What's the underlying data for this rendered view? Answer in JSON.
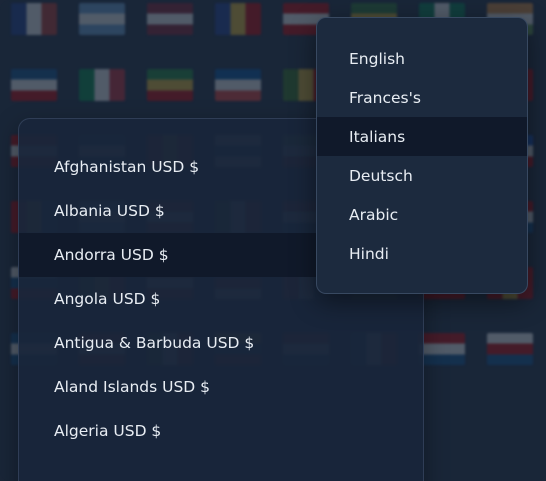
{
  "background_flags": [
    [
      "#1b3a8f",
      "#ffffff",
      "#c0392b"
    ],
    [
      "#6fa8dc",
      "#ffffff",
      "#6fa8dc"
    ],
    [
      "#8b1e2d",
      "#ffffff",
      "#8b1e2d"
    ],
    [
      "#1f3f9a",
      "#f1c232",
      "#cc0000"
    ],
    [
      "#cc0000",
      "#ffffff",
      "#cc0000"
    ],
    [
      "#2e7d32",
      "#f1c232",
      "#1565c0"
    ],
    [
      "#008751",
      "#ffffff",
      "#008751"
    ],
    [
      "#e69138",
      "#ffffff",
      "#6aa84f"
    ],
    [
      "#0b5394",
      "#ffffff",
      "#cc0000"
    ],
    [
      "#009246",
      "#ffffff",
      "#ce2b37"
    ],
    [
      "#1e8f3a",
      "#f1c232",
      "#cc0000"
    ],
    [
      "#0055a4",
      "#ffffff",
      "#ef4135"
    ],
    [
      "#38761d",
      "#f1c232",
      "#cc0000"
    ],
    [
      "#cc0000",
      "#ffffff",
      "#0b5394"
    ],
    [
      "#ffffff",
      "#cc0000",
      "#ffffff"
    ],
    [
      "#3d85c6",
      "#ffffff",
      "#cc0000"
    ],
    [
      "#cc0000",
      "#ffffff",
      "#cc0000"
    ],
    [
      "#0b5394",
      "#ffffff",
      "#0b5394"
    ],
    [
      "#cc0000",
      "#f1c232",
      "#cc0000"
    ],
    [
      "#ffffff",
      "#0b5394",
      "#ffffff"
    ],
    [
      "#6aa84f",
      "#ffffff",
      "#cc0000"
    ],
    [
      "#cc0000",
      "#ffffff",
      "#0b5394"
    ],
    [
      "#0b5394",
      "#ffffff",
      "#cc0000"
    ],
    [
      "#1155cc",
      "#ffffff",
      "#cc0000"
    ],
    [
      "#cc0000",
      "#f1c232",
      "#0b5394"
    ],
    [
      "#6fa8dc",
      "#ffffff",
      "#6fa8dc"
    ],
    [
      "#cc0000",
      "#ffffff",
      "#cc0000"
    ],
    [
      "#38761d",
      "#ffffff",
      "#cc0000"
    ],
    [
      "#cc0000",
      "#ffffff",
      "#0b5394"
    ],
    [
      "#0b5394",
      "#ffffff",
      "#cc0000"
    ],
    [
      "#ffffff",
      "#cc0000",
      "#0b5394"
    ],
    [
      "#cc0000",
      "#ffffff",
      "#0b5394"
    ],
    [
      "#ffffff",
      "#0b5394",
      "#cc0000"
    ],
    [
      "#38761d",
      "#f1c232",
      "#cc0000"
    ],
    [
      "#cc0000",
      "#ffffff",
      "#cc0000"
    ],
    [
      "#0b5394",
      "#cc0000",
      "#ffffff"
    ],
    [
      "#cc0000",
      "#ffffff",
      "#0b5394"
    ],
    [
      "#6aa84f",
      "#ffffff",
      "#6aa84f"
    ],
    [
      "#cc0000",
      "#0b5394",
      "#cc0000"
    ],
    [
      "#cc0000",
      "#f1c232",
      "#cc0000"
    ],
    [
      "#0b5394",
      "#ffffff",
      "#0b5394"
    ],
    [
      "#cc0000",
      "#ffffff",
      "#cc0000"
    ],
    [
      "#38761d",
      "#ffffff",
      "#cc0000"
    ],
    [
      "#f1c232",
      "#0b5394",
      "#cc0000"
    ],
    [
      "#cc0000",
      "#ffffff",
      "#0b5394"
    ],
    [
      "#0b5394",
      "#ffffff",
      "#cc0000"
    ],
    [
      "#cc0000",
      "#ffffff",
      "#0b5394"
    ],
    [
      "#ffffff",
      "#cc0000",
      "#0b5394"
    ]
  ],
  "country_list": {
    "items": [
      {
        "label": "Afghanistan USD $",
        "active": false
      },
      {
        "label": "Albania USD $",
        "active": false
      },
      {
        "label": "Andorra USD $",
        "active": true
      },
      {
        "label": "Angola USD $",
        "active": false
      },
      {
        "label": "Antigua & Barbuda USD $",
        "active": false
      },
      {
        "label": "Aland Islands USD $",
        "active": false
      },
      {
        "label": "Algeria USD $",
        "active": false
      }
    ]
  },
  "language_menu": {
    "items": [
      {
        "label": "English",
        "active": false
      },
      {
        "label": "Frances's",
        "active": false
      },
      {
        "label": "Italians",
        "active": true
      },
      {
        "label": "Deutsch",
        "active": false
      },
      {
        "label": "Arabic",
        "active": false
      },
      {
        "label": "Hindi",
        "active": false
      }
    ]
  }
}
